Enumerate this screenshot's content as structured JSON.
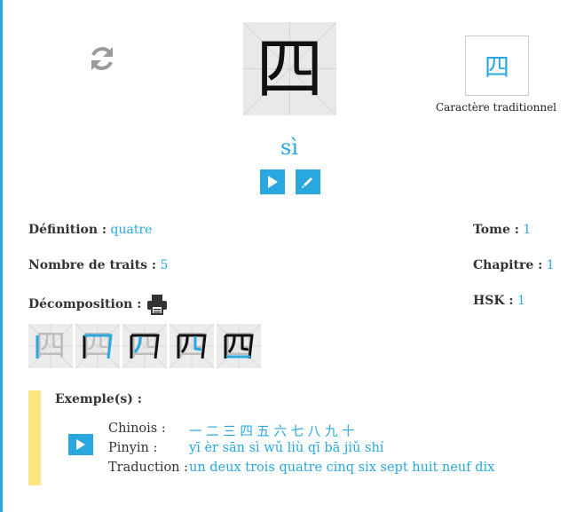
{
  "character": {
    "simplified": "四",
    "traditional": "四",
    "traditional_label": "Caractère traditionnel",
    "pinyin": "sì"
  },
  "icons": {
    "refresh": "refresh-icon",
    "play": "play-icon",
    "edit": "pencil-icon",
    "print": "print-icon"
  },
  "info": {
    "definition_label": "Définition :",
    "definition_value": "quatre",
    "strokes_label": "Nombre de traits :",
    "strokes_value": "5",
    "decomposition_label": "Décomposition :",
    "tome_label": "Tome :",
    "tome_value": "1",
    "chapitre_label": "Chapitre :",
    "chapitre_value": "1",
    "hsk_label": "HSK :",
    "hsk_value": "1"
  },
  "stroke_order": [
    {
      "glyph": "四"
    },
    {
      "glyph": "四"
    },
    {
      "glyph": "四"
    },
    {
      "glyph": "四"
    },
    {
      "glyph": "四"
    }
  ],
  "example": {
    "title": "Exemple(s) :",
    "chinois_label": "Chinois :",
    "chinois_value": "一 二 三 四 五 六 七 八 九 十",
    "pinyin_label": "Pinyin :",
    "pinyin_value": "yī èr sān sì wǔ liù qī bā jiǔ shí",
    "traduction_label": "Traduction :",
    "traduction_value": "un deux trois quatre cinq six sept huit neuf dix"
  },
  "colors": {
    "accent": "#29a8e0",
    "highlight_bar": "#fbe67f",
    "char_bg": "#e9e9e9"
  }
}
